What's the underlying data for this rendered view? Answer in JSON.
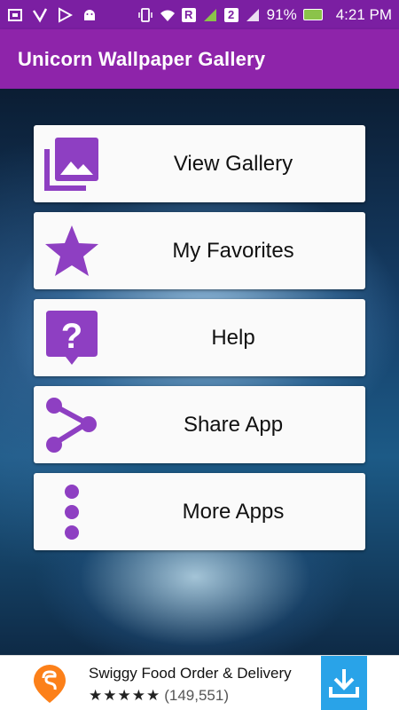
{
  "status": {
    "battery": "91%",
    "time": "4:21 PM",
    "network_badge_r": "R",
    "sim_badge": "2"
  },
  "appbar": {
    "title": "Unicorn Wallpaper Gallery"
  },
  "menu": {
    "items": [
      {
        "label": "View Gallery",
        "icon": "gallery-icon"
      },
      {
        "label": "My Favorites",
        "icon": "star-icon"
      },
      {
        "label": "Help",
        "icon": "help-icon"
      },
      {
        "label": "Share App",
        "icon": "share-icon"
      },
      {
        "label": "More Apps",
        "icon": "more-vertical-icon"
      }
    ]
  },
  "ad": {
    "app_name": "Swiggy Food Order & Delivery",
    "stars": "★★★★★",
    "rating_count": "(149,551)",
    "info": "ⓘ ✕"
  },
  "colors": {
    "primary": "#8e24aa",
    "status": "#7b1fa2",
    "icon": "#8e3fc2",
    "download": "#29a3e8"
  }
}
